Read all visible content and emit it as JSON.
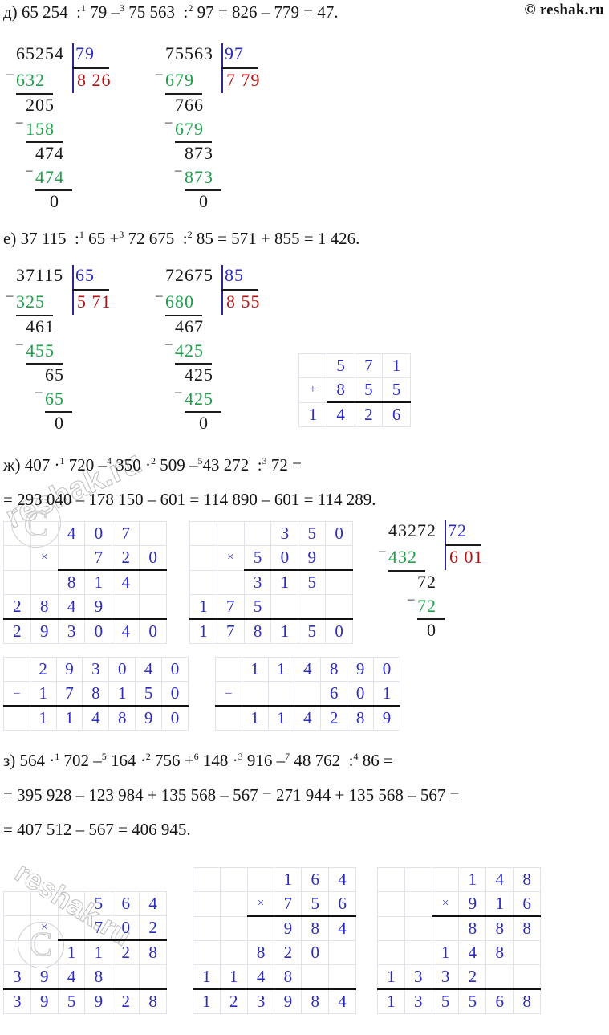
{
  "watermark": {
    "top_right": "© reshak.ru",
    "ghost_text": "reshak.ru",
    "ghost_c": "C"
  },
  "problems": [
    {
      "id": "d",
      "label": "д)",
      "expression_parts": [
        {
          "t": "д) 65 254  :"
        },
        {
          "sup": "1"
        },
        {
          "t": " 79 –"
        },
        {
          "sup": "3"
        },
        {
          "t": " 75 563  :"
        },
        {
          "sup": "2"
        },
        {
          "t": " 97 = 826 – 779 = 47."
        }
      ],
      "expression_plain": "д) 65 254  :1 79 –3 75 563  :2 97 = 826 – 779 = 47."
    },
    {
      "id": "e",
      "label": "е)",
      "expression_plain": "е) 37 115  :1 65 +3 72 675  :2 85 = 571 + 855 = 1 426."
    },
    {
      "id": "zh",
      "label": "ж)",
      "expression_plain": "ж) 407 ·1 720 –4 350 ·2 509 –543 272  :3 72 =",
      "expression2_plain": "= 293 040 – 178 150 – 601 = 114 890 – 601 = 114 289."
    },
    {
      "id": "z",
      "label": "з)",
      "expression_plain": "з) 564 ·1 702 –5 164 ·2 756 +6 148 ·3 916 –7 48 762  :4 86 =",
      "expression2_plain": "= 395 928 – 123 984 + 135 568 – 567 = 271 944 + 135 568 – 567 =",
      "expression3_plain": "= 407 512 – 567 = 406 945."
    }
  ],
  "long_divisions": [
    {
      "name": "65254-by-79",
      "dividend": "65254",
      "divisor": "79",
      "quotient": "8 26",
      "steps": [
        "632",
        "205",
        "158",
        "474",
        "474",
        "0"
      ]
    },
    {
      "name": "75563-by-97",
      "dividend": "75563",
      "divisor": "97",
      "quotient": "7 79",
      "steps": [
        "679",
        "766",
        "679",
        "873",
        "873",
        "0"
      ]
    },
    {
      "name": "37115-by-65",
      "dividend": "37115",
      "divisor": "65",
      "quotient": "5 71",
      "steps": [
        "325",
        "461",
        "455",
        "65",
        "65",
        "0"
      ]
    },
    {
      "name": "72675-by-85",
      "dividend": "72675",
      "divisor": "85",
      "quotient": "8 55",
      "steps": [
        "680",
        "467",
        "425",
        "425",
        "425",
        "0"
      ]
    },
    {
      "name": "43272-by-72",
      "dividend": "43272",
      "divisor": "72",
      "quotient": "6 01",
      "steps": [
        "432",
        "72",
        "72",
        "0"
      ]
    }
  ],
  "grids": [
    {
      "name": "addition-571-plus-855",
      "type": "addition",
      "cols": 4,
      "rows": [
        [
          "",
          "5",
          "7",
          "1"
        ],
        [
          "+",
          "8",
          "5",
          "5"
        ],
        [
          "1",
          "4",
          "2",
          "6"
        ]
      ]
    },
    {
      "name": "multiply-407-by-720",
      "type": "multiplication",
      "cols": 6,
      "rows": [
        [
          "",
          "",
          "4",
          "0",
          "7",
          ""
        ],
        [
          "",
          "×",
          "",
          "7",
          "2",
          "0"
        ],
        [
          "",
          "",
          "8",
          "1",
          "4",
          ""
        ],
        [
          "2",
          "8",
          "4",
          "9",
          "",
          ""
        ],
        [
          "2",
          "9",
          "3",
          "0",
          "4",
          "0"
        ]
      ]
    },
    {
      "name": "multiply-350-by-509",
      "type": "multiplication",
      "cols": 6,
      "rows": [
        [
          "",
          "",
          "",
          "3",
          "5",
          "0"
        ],
        [
          "",
          "×",
          "5",
          "0",
          "9",
          ""
        ],
        [
          "",
          "",
          "3",
          "1",
          "5",
          ""
        ],
        [
          "1",
          "7",
          "5",
          "",
          "",
          ""
        ],
        [
          "1",
          "7",
          "8",
          "1",
          "5",
          "0"
        ]
      ]
    },
    {
      "name": "subtract-293040-minus-178150",
      "type": "subtraction",
      "cols": 7,
      "rows": [
        [
          "",
          "2",
          "9",
          "3",
          "0",
          "4",
          "0"
        ],
        [
          "–",
          "1",
          "7",
          "8",
          "1",
          "5",
          "0"
        ],
        [
          "",
          "1",
          "1",
          "4",
          "8",
          "9",
          "0"
        ]
      ]
    },
    {
      "name": "subtract-114890-minus-601",
      "type": "subtraction",
      "cols": 7,
      "rows": [
        [
          "",
          "1",
          "1",
          "4",
          "8",
          "9",
          "0"
        ],
        [
          "–",
          "",
          "",
          "",
          "6",
          "0",
          "1"
        ],
        [
          "",
          "1",
          "1",
          "4",
          "2",
          "8",
          "9"
        ]
      ]
    },
    {
      "name": "multiply-564-by-702",
      "type": "multiplication",
      "cols": 6,
      "rows": [
        [
          "",
          "",
          "",
          "5",
          "6",
          "4"
        ],
        [
          "",
          "×",
          "",
          "7",
          "0",
          "2"
        ],
        [
          "",
          "",
          "1",
          "1",
          "2",
          "8"
        ],
        [
          "3",
          "9",
          "4",
          "8",
          "",
          ""
        ],
        [
          "3",
          "9",
          "5",
          "9",
          "2",
          "8"
        ]
      ]
    },
    {
      "name": "multiply-164-by-756",
      "type": "multiplication",
      "cols": 6,
      "rows": [
        [
          "",
          "",
          "",
          "1",
          "6",
          "4"
        ],
        [
          "",
          "",
          "×",
          "7",
          "5",
          "6"
        ],
        [
          "",
          "",
          "",
          "9",
          "8",
          "4"
        ],
        [
          "",
          "",
          "8",
          "2",
          "0",
          ""
        ],
        [
          "1",
          "1",
          "4",
          "8",
          "",
          ""
        ],
        [
          "1",
          "2",
          "3",
          "9",
          "8",
          "4"
        ]
      ]
    },
    {
      "name": "multiply-148-by-916",
      "type": "multiplication",
      "cols": 6,
      "rows": [
        [
          "",
          "",
          "",
          "1",
          "4",
          "8"
        ],
        [
          "",
          "",
          "×",
          "9",
          "1",
          "6"
        ],
        [
          "",
          "",
          "",
          "8",
          "8",
          "8"
        ],
        [
          "",
          "",
          "1",
          "4",
          "8",
          ""
        ],
        [
          "1",
          "3",
          "3",
          "2",
          "",
          ""
        ],
        [
          "1",
          "3",
          "5",
          "5",
          "6",
          "8"
        ]
      ]
    }
  ],
  "colors": {
    "blue": "#2b2bc4",
    "green": "#1f9e4b",
    "red": "#b01515",
    "dark": "#1a1a1a",
    "grid_line": "#e2e2ea"
  }
}
